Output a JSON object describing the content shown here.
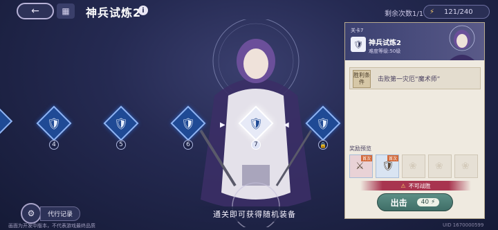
{
  "header": {
    "back_icon": "back-arrow-icon",
    "menu_icon": "grid-icon",
    "title": "神兵试炼2",
    "info_icon": "i",
    "remaining_label": "剩余次数1/1",
    "energy": "121/240",
    "energy_plus": "+"
  },
  "stages": [
    {
      "num": "4"
    },
    {
      "num": "5"
    },
    {
      "num": "6"
    },
    {
      "num": "7"
    }
  ],
  "bottom": {
    "banner": "通关即可获得随机装备",
    "proxy_label": "代行记录",
    "footnote": "画面为开发中版本，不代表游戏最终品质",
    "uid": "UID 1670000599"
  },
  "panel": {
    "stage_no": "关卡7",
    "title": "神兵试炼2",
    "difficulty": "难度等级:50级",
    "win_tag": "胜利条件",
    "win_condition": "击败第一灾厄“魔术师”",
    "reward_title": "奖励预览",
    "first_tag": "首次",
    "warning": "不可战胜",
    "sortie_label": "出击",
    "sortie_cost": "40"
  },
  "colors": {
    "accent_blue": "#1f4a95",
    "panel_bg": "#efeae0",
    "sortie_green": "#4f7f77",
    "warn_red": "#a8344f"
  }
}
